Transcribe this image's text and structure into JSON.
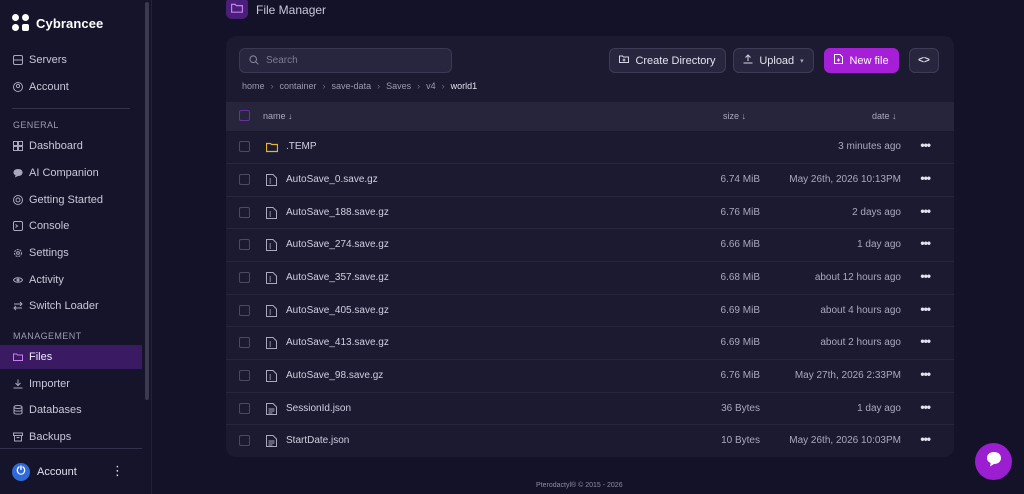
{
  "brand": {
    "name": "Cybrancee"
  },
  "sidebar": {
    "top_items": [
      {
        "label": "Servers",
        "icon": "server-icon"
      },
      {
        "label": "Account",
        "icon": "user-circle-icon"
      }
    ],
    "general_label": "GENERAL",
    "general_items": [
      {
        "label": "Dashboard",
        "icon": "dashboard-icon"
      },
      {
        "label": "AI Companion",
        "icon": "chat-icon"
      },
      {
        "label": "Getting Started",
        "icon": "lifebuoy-icon"
      },
      {
        "label": "Console",
        "icon": "terminal-icon"
      },
      {
        "label": "Settings",
        "icon": "gear-icon"
      },
      {
        "label": "Activity",
        "icon": "eye-icon"
      },
      {
        "label": "Switch Loader",
        "icon": "swap-icon"
      }
    ],
    "management_label": "MANAGEMENT",
    "management_items": [
      {
        "label": "Files",
        "icon": "folder-icon",
        "active": true
      },
      {
        "label": "Importer",
        "icon": "download-icon"
      },
      {
        "label": "Databases",
        "icon": "database-icon"
      },
      {
        "label": "Backups",
        "icon": "archive-icon"
      }
    ],
    "account_label": "Account"
  },
  "header": {
    "title": "File Manager"
  },
  "toolbar": {
    "search_placeholder": "Search",
    "create_directory": "Create Directory",
    "upload": "Upload",
    "new_file": "New file"
  },
  "breadcrumb": [
    "home",
    "container",
    "save-data",
    "Saves",
    "v4"
  ],
  "breadcrumb_current": "world1",
  "table": {
    "col_name": "name ↓",
    "col_size": "size ↓",
    "col_date": "date ↓",
    "rows": [
      {
        "name": ".TEMP",
        "type": "folder",
        "size": "",
        "date": "3 minutes ago"
      },
      {
        "name": "AutoSave_0.save.gz",
        "type": "archive",
        "size": "6.74 MiB",
        "date": "May 26th, 2026 10:13PM"
      },
      {
        "name": "AutoSave_188.save.gz",
        "type": "archive",
        "size": "6.76 MiB",
        "date": "2 days ago"
      },
      {
        "name": "AutoSave_274.save.gz",
        "type": "archive",
        "size": "6.66 MiB",
        "date": "1 day ago"
      },
      {
        "name": "AutoSave_357.save.gz",
        "type": "archive",
        "size": "6.68 MiB",
        "date": "about 12 hours ago"
      },
      {
        "name": "AutoSave_405.save.gz",
        "type": "archive",
        "size": "6.69 MiB",
        "date": "about 4 hours ago"
      },
      {
        "name": "AutoSave_413.save.gz",
        "type": "archive",
        "size": "6.69 MiB",
        "date": "about 2 hours ago"
      },
      {
        "name": "AutoSave_98.save.gz",
        "type": "archive",
        "size": "6.76 MiB",
        "date": "May 27th, 2026 2:33PM"
      },
      {
        "name": "SessionId.json",
        "type": "text",
        "size": "36 Bytes",
        "date": "1 day ago"
      },
      {
        "name": "StartDate.json",
        "type": "text",
        "size": "10 Bytes",
        "date": "May 26th, 2026 10:03PM"
      }
    ]
  },
  "footer": "Pterodactyl® © 2015 - 2026",
  "colors": {
    "accent": "#a51fd6",
    "background": "#131228",
    "card": "#1b1a31",
    "folder": "#e5b62c"
  }
}
